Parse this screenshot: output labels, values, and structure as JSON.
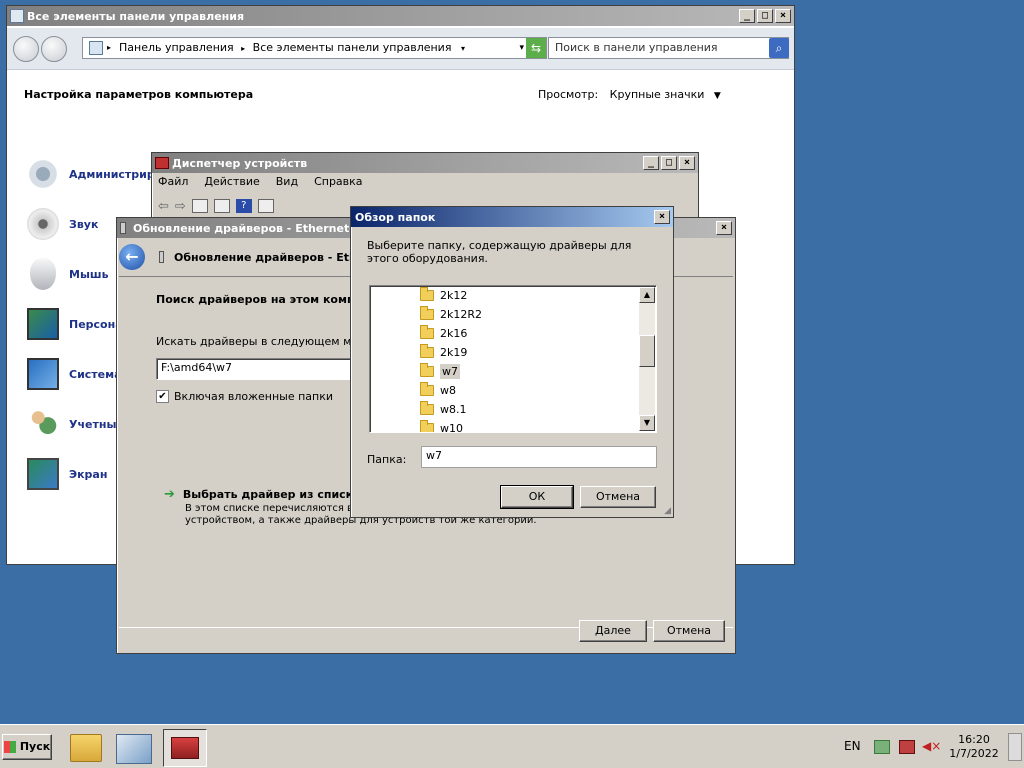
{
  "control_panel": {
    "title": "Все элементы панели управления",
    "breadcrumb": [
      "Панель управления",
      "Все элементы панели управления"
    ],
    "search_placeholder": "Поиск в панели управления",
    "heading": "Настройка параметров компьютера",
    "view_label": "Просмотр:",
    "view_value": "Крупные значки",
    "items": [
      {
        "label": "Администрир",
        "icon": "admin-tools-icon"
      },
      {
        "label": "Звук",
        "icon": "speaker-icon"
      },
      {
        "label": "Мышь",
        "icon": "mouse-icon"
      },
      {
        "label": "Персона",
        "icon": "personalization-icon"
      },
      {
        "label": "Система",
        "icon": "system-icon"
      },
      {
        "label": "Учетны",
        "icon": "user-accounts-icon"
      },
      {
        "label": "Экран",
        "icon": "display-icon"
      }
    ]
  },
  "device_manager": {
    "title": "Диспетчер устройств",
    "menu": [
      "Файл",
      "Действие",
      "Вид",
      "Справка"
    ]
  },
  "driver_update": {
    "title": "Обновление драйверов - Ethernet-ко",
    "header": "Обновление драйверов - Ethe",
    "search_heading": "Поиск драйверов на этом компь",
    "path_label": "Искать драйверы в следующем ме",
    "path_value": "F:\\amd64\\w7",
    "include_subfolders": "Включая вложенные папки",
    "pick_link": "Выбрать драйвер из списка",
    "pick_desc_line1": "В этом списке перечисляются вс",
    "pick_desc_line2": "устройством, а также драйверы для устройств той же категории.",
    "next_button": "Далее",
    "cancel_button": "Отмена"
  },
  "browse_dialog": {
    "title": "Обзор папок",
    "prompt": "Выберите папку, содержащую драйверы для этого оборудования.",
    "folders": [
      "2k12",
      "2k12R2",
      "2k16",
      "2k19",
      "w7",
      "w8",
      "w8.1",
      "w10"
    ],
    "selected_folder": "w7",
    "folder_label": "Папка:",
    "folder_value": "w7",
    "ok_button": "ОК",
    "cancel_button": "Отмена"
  },
  "taskbar": {
    "start_label": "Пуск",
    "language": "EN",
    "time": "16:20",
    "date": "1/7/2022"
  }
}
